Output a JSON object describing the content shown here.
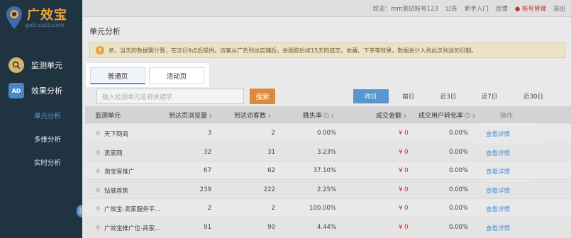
{
  "brand": {
    "name": "广效宝",
    "url": "gxb.cnzz.com"
  },
  "topbar": {
    "welcome": "欢迎：",
    "account_name": "mm测试账号123",
    "announcement": "公告",
    "beginner": "新手入门",
    "feedback": "反馈",
    "account_mgmt": "账号管理",
    "logout": "退出"
  },
  "sidebar": {
    "monitor": "监测单元",
    "effect": "效果分析",
    "sub": [
      "单元分析",
      "多维分析",
      "实时分析"
    ]
  },
  "page": {
    "title": "单元分析",
    "notice": "亲，当天的数据需计算，在次日9点后提供。访客从广告到达店铺后，会跟踪后续15天的成交、收藏、下单等效果，数据会计入到此次到达的日期。",
    "tabs": [
      "普通页",
      "活动页"
    ],
    "search_placeholder": "输入检测单元名称关键字",
    "search_button": "搜索",
    "date_ranges": [
      "昨日",
      "前日",
      "近3日",
      "近7日",
      "近30日"
    ]
  },
  "table": {
    "headers": [
      "监测单元",
      "到达页浏览量",
      "到达访客数",
      "跳失率",
      "成交金额",
      "成交用户转化率",
      "操作"
    ],
    "rows": [
      {
        "name": "天下网商",
        "pv": "3",
        "uv": "2",
        "bounce": "0.00%",
        "amount": "¥ 0",
        "conv": "0.00%",
        "action": "查看详情"
      },
      {
        "name": "卖家网",
        "pv": "32",
        "uv": "31",
        "bounce": "3.23%",
        "amount": "¥ 0",
        "conv": "0.00%",
        "action": "查看详情"
      },
      {
        "name": "淘宝客推广",
        "pv": "67",
        "uv": "62",
        "bounce": "37.10%",
        "amount": "¥ 0",
        "conv": "0.00%",
        "action": "查看详情"
      },
      {
        "name": "钻展首焦",
        "pv": "239",
        "uv": "222",
        "bounce": "2.25%",
        "amount": "¥ 0",
        "conv": "0.00%",
        "action": "查看详情"
      },
      {
        "name": "广效宝-卖家服务平...",
        "pv": "2",
        "uv": "2",
        "bounce": "100.00%",
        "amount": "¥ 0",
        "conv": "0.00%",
        "action": "查看详情"
      },
      {
        "name": "广效宝推广位-商家...",
        "pv": "91",
        "uv": "90",
        "bounce": "4.44%",
        "amount": "¥ 0",
        "conv": "0.00%",
        "action": "查看详情"
      }
    ]
  },
  "colors": {
    "accent": "#5b95cf",
    "brand": "#f0a43a",
    "money": "#c2332d",
    "sidebar": "#1f3340"
  }
}
